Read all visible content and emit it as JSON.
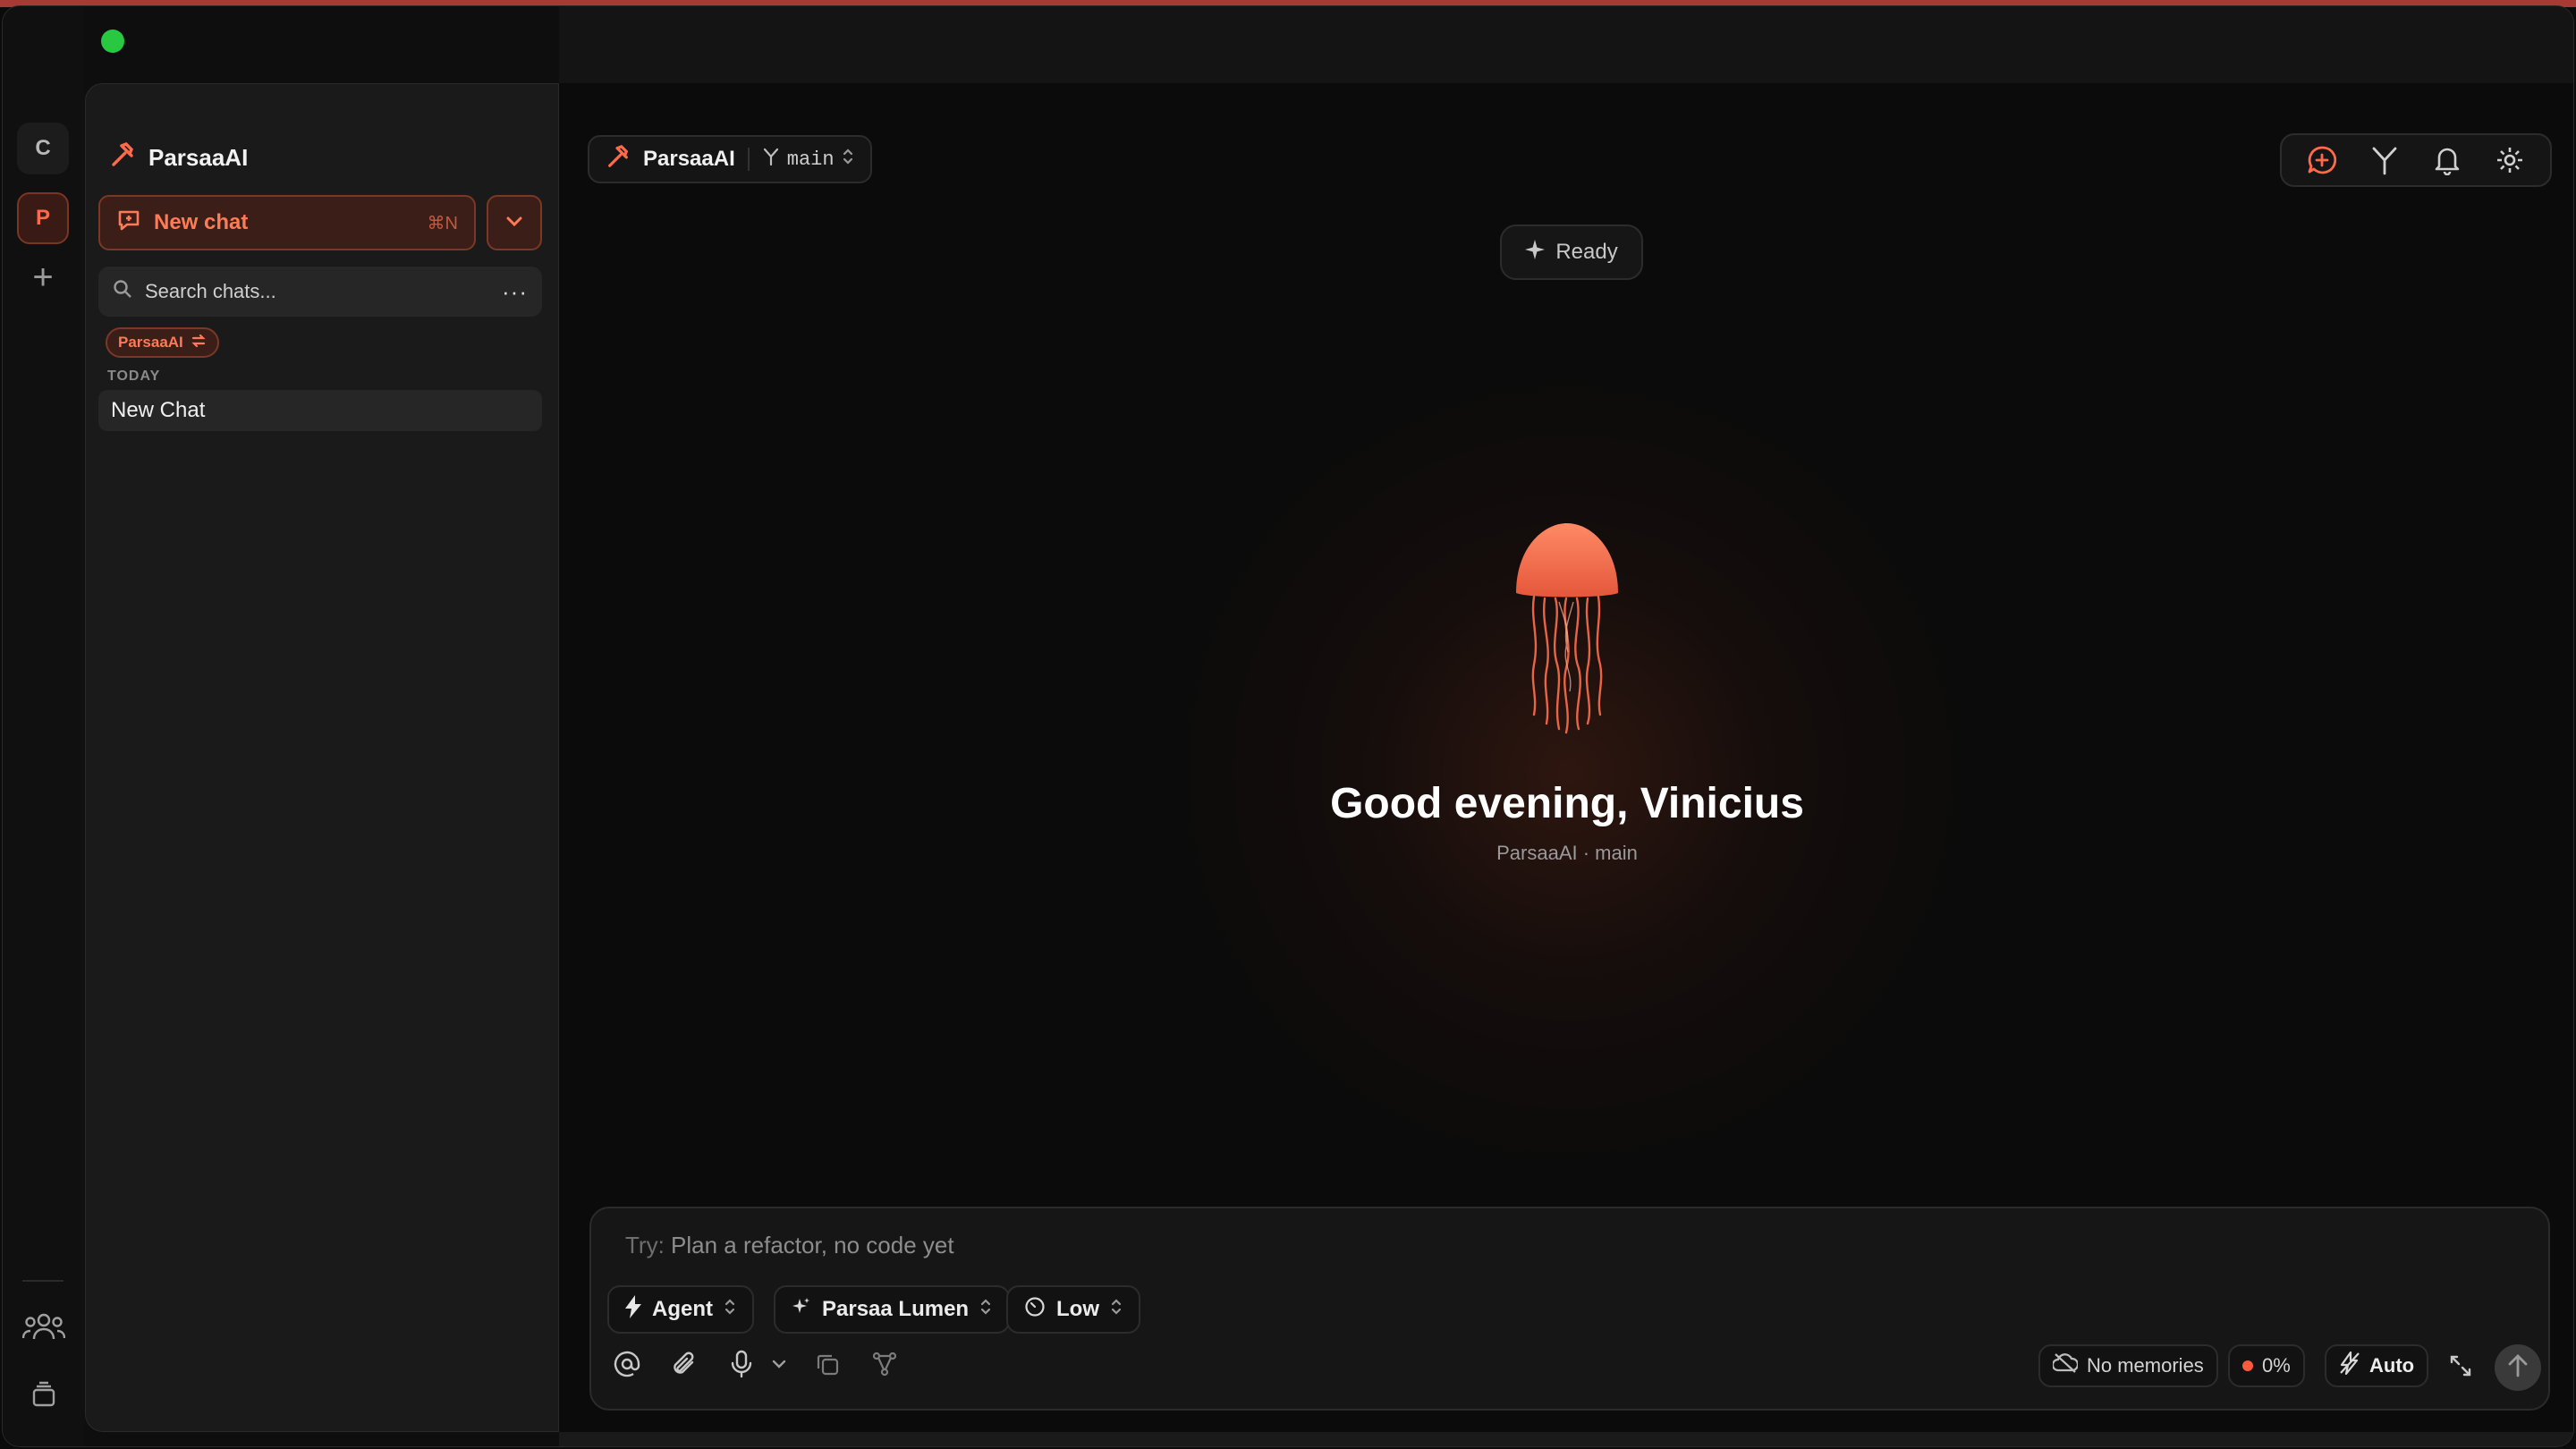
{
  "window": {
    "traffic_colors": [
      "#ff5f57",
      "#febc2e",
      "#28c840"
    ]
  },
  "rail": {
    "workspace_c": "C",
    "workspace_p": "P",
    "add": "+"
  },
  "sidebar": {
    "project_name": "ParsaaAI",
    "new_chat_label": "New chat",
    "new_chat_shortcut": "⌘N",
    "search_placeholder": "Search chats...",
    "more": "···",
    "filter_tag": "ParsaaAI",
    "section_today": "TODAY",
    "chats": [
      "New Chat"
    ]
  },
  "header": {
    "project": "ParsaaAI",
    "branch": "main",
    "tools": [
      "new-chat-icon",
      "branch-icon",
      "bell-icon",
      "settings-icon"
    ]
  },
  "status": {
    "ready": "Ready"
  },
  "hero": {
    "greeting": "Good evening, Vinicius",
    "subtitle": "ParsaaAI · main"
  },
  "composer": {
    "placeholder_prefix": "Try:",
    "placeholder": "Plan a refactor, no code yet",
    "mode": "Agent",
    "model": "Parsaa Lumen",
    "effort": "Low",
    "memories": "No memories",
    "context": "0%",
    "auto": "Auto"
  },
  "colors": {
    "accent": "#ff6b4a",
    "accent_bg": "#3b1e17",
    "background": "#0b0b0b"
  }
}
